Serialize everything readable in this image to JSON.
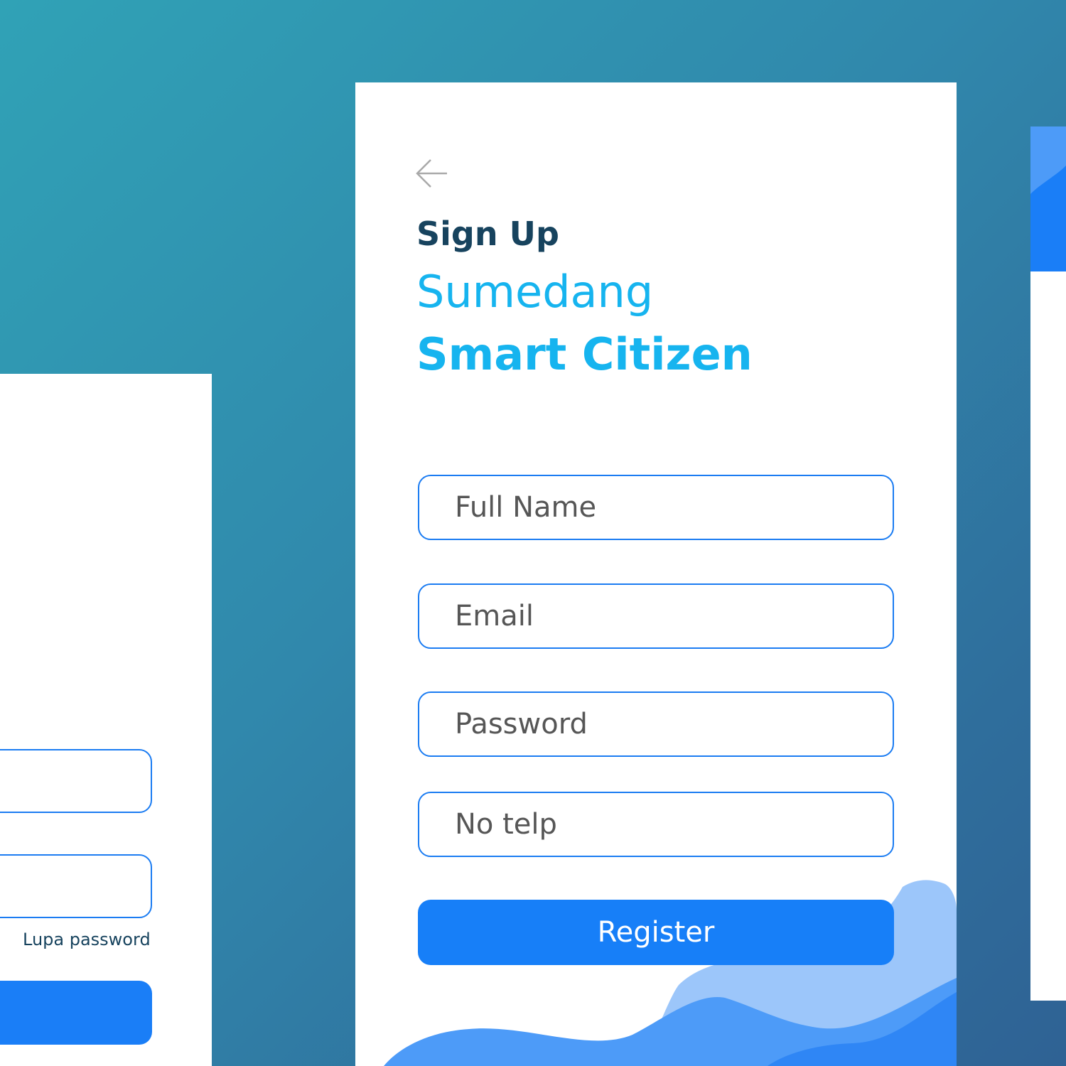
{
  "left_card": {
    "forgot_password_label": "Lupa password"
  },
  "signup_card": {
    "back_icon": "arrow-left-icon",
    "heading": "Sign Up",
    "brand_line1": "Sumedang",
    "brand_line2": "Smart Citizen",
    "fields": [
      {
        "placeholder": "Full Name"
      },
      {
        "placeholder": "Email"
      },
      {
        "placeholder": "Password"
      },
      {
        "placeholder": "No telp"
      }
    ],
    "register_label": "Register"
  },
  "colors": {
    "primary_blue": "#177ff8",
    "brand_cyan": "#16b4ef",
    "heading_dark": "#17435e",
    "wave_light": "#9cc6fa",
    "wave_mid": "#4d9bf8"
  }
}
